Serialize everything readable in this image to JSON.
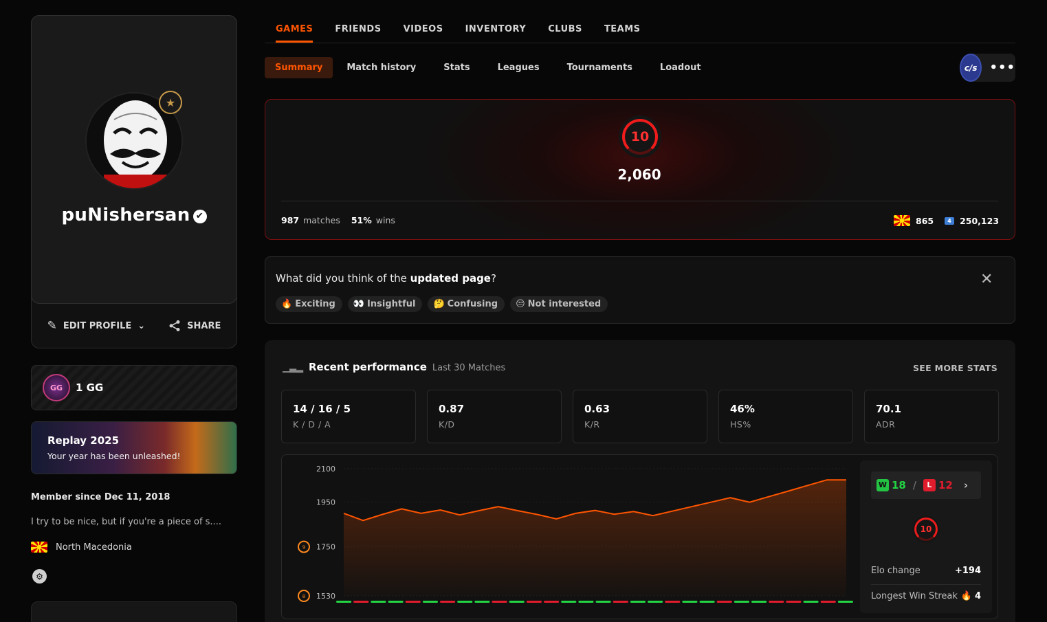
{
  "profile": {
    "username": "puNishersan",
    "edit_label": "EDIT PROFILE",
    "share_label": "SHARE",
    "gg_label": "1 GG",
    "replay_title": "Replay 2025",
    "replay_sub": "Your year has been unleashed!",
    "member_since": "Member since Dec 11, 2018",
    "bio": "I try to be nice, but if you're a piece of s....",
    "country": "North Macedonia"
  },
  "nav": {
    "tabs": [
      "GAMES",
      "FRIENDS",
      "VIDEOS",
      "INVENTORY",
      "CLUBS",
      "TEAMS"
    ],
    "active_tab": "GAMES",
    "subtabs": [
      "Summary",
      "Match history",
      "Stats",
      "Leagues",
      "Tournaments",
      "Loadout"
    ],
    "active_subtab": "Summary",
    "game_logo": "c/s",
    "more": "•••"
  },
  "elo": {
    "level": "10",
    "value": "2,060",
    "matches": "987",
    "matches_label": "matches",
    "winrate": "51%",
    "wins_label": "wins",
    "country_rank": "865",
    "region_rank": "250,123",
    "region_icon": "4",
    "accent": "#ff5500"
  },
  "feedback": {
    "question_prefix": "What did you think of the ",
    "question_bold": "updated page",
    "question_suffix": "?",
    "options": [
      {
        "emoji": "🔥",
        "label": "Exciting"
      },
      {
        "emoji": "👀",
        "label": "Insightful"
      },
      {
        "emoji": "🤔",
        "label": "Confusing"
      },
      {
        "emoji": "😒",
        "label": "Not interested"
      }
    ],
    "close": "✕"
  },
  "performance": {
    "title": "Recent performance",
    "subtitle": "Last 30 Matches",
    "see_more": "SEE MORE STATS",
    "stats": [
      {
        "value": "14 / 16 / 5",
        "label": "K / D / A"
      },
      {
        "value": "0.87",
        "label": "K/D"
      },
      {
        "value": "0.63",
        "label": "K/R"
      },
      {
        "value": "46%",
        "label": "HS%"
      },
      {
        "value": "70.1",
        "label": "ADR"
      }
    ],
    "wins": "18",
    "losses": "12",
    "w_label": "W",
    "l_label": "L",
    "side_level": "10",
    "elo_change_label": "Elo change",
    "elo_change": "+194",
    "streak_label": "Longest Win Streak",
    "streak_icon": "🔥",
    "streak": "4"
  },
  "chart_data": {
    "type": "area",
    "y_ticks": [
      2100,
      1950,
      1750,
      1530
    ],
    "y_tick_levels": [
      "",
      "",
      "9",
      "8"
    ],
    "ylim": [
      1530,
      2100
    ],
    "values": [
      1900,
      1868,
      1895,
      1920,
      1900,
      1915,
      1893,
      1912,
      1930,
      1912,
      1895,
      1875,
      1900,
      1913,
      1896,
      1908,
      1890,
      1910,
      1930,
      1950,
      1970,
      1950,
      1975,
      2000,
      2025,
      2050,
      2050
    ],
    "results": [
      "W",
      "L",
      "W",
      "W",
      "L",
      "W",
      "L",
      "W",
      "W",
      "L",
      "W",
      "L",
      "L",
      "W",
      "W",
      "W",
      "L",
      "W",
      "W",
      "L",
      "W",
      "W",
      "L",
      "W",
      "W",
      "L",
      "L",
      "W",
      "L",
      "W"
    ],
    "line_color": "#ff5500",
    "win_color": "#23d443",
    "loss_color": "#e01c2d"
  }
}
